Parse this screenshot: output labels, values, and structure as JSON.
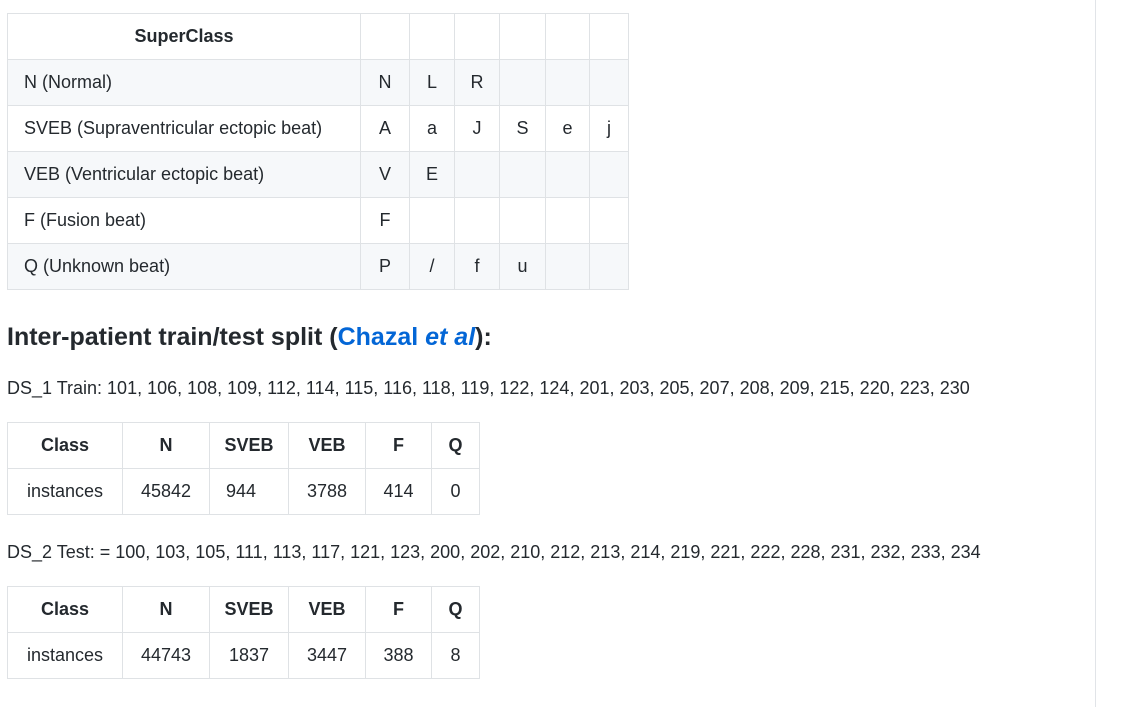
{
  "superclass_table": {
    "header": "SuperClass",
    "rows": [
      {
        "name": "N (Normal)",
        "symbols": [
          "N",
          "L",
          "R",
          "",
          "",
          ""
        ]
      },
      {
        "name": "SVEB (Supraventricular ectopic beat)",
        "symbols": [
          "A",
          "a",
          "J",
          "S",
          "e",
          "j"
        ]
      },
      {
        "name": "VEB (Ventricular ectopic beat)",
        "symbols": [
          "V",
          "E",
          "",
          "",
          "",
          ""
        ]
      },
      {
        "name": "F (Fusion beat)",
        "symbols": [
          "F",
          "",
          "",
          "",
          "",
          ""
        ]
      },
      {
        "name": "Q (Unknown beat)",
        "symbols": [
          "P",
          "/",
          "f",
          "u",
          "",
          ""
        ]
      }
    ]
  },
  "heading": {
    "prefix": "Inter-patient train/test split (",
    "link_text": "Chazal ",
    "link_italic": "et al",
    "suffix": "):"
  },
  "train": {
    "line": "DS_1 Train: 101, 106, 108, 109, 112, 114, 115, 116, 118, 119, 122, 124, 201, 203, 205, 207, 208, 209, 215, 220, 223, 230",
    "headers": [
      "Class",
      "N",
      "SVEB",
      "VEB",
      "F",
      "Q"
    ],
    "row_label": "instances",
    "values": [
      "45842",
      "944",
      "3788",
      "414",
      "0"
    ]
  },
  "test": {
    "line": "DS_2 Test: = 100, 103, 105, 111, 113, 117, 121, 123, 200, 202, 210, 212, 213, 214, 219, 221, 222, 228, 231, 232, 233, 234",
    "headers": [
      "Class",
      "N",
      "SVEB",
      "VEB",
      "F",
      "Q"
    ],
    "row_label": "instances",
    "values": [
      "44743",
      "1837",
      "3447",
      "388",
      "8"
    ]
  },
  "colors": {
    "link": "#0366d6",
    "text": "#24292e",
    "border": "#dfe2e5",
    "stripe": "#f6f8fa"
  }
}
